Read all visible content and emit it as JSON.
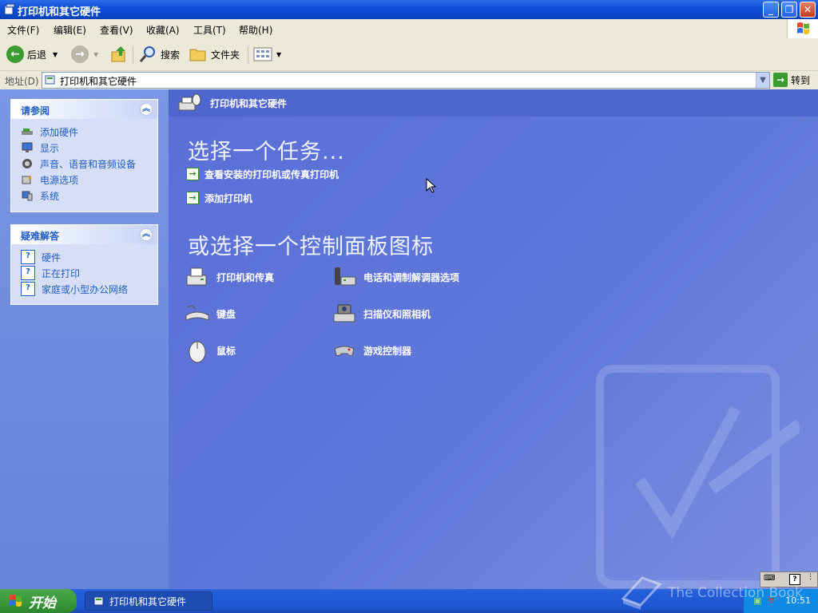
{
  "window": {
    "title": "打印机和其它硬件",
    "buttons": {
      "minimize": "_",
      "restore": "❐",
      "close": "✕"
    }
  },
  "menu": [
    "文件(F)",
    "编辑(E)",
    "查看(V)",
    "收藏(A)",
    "工具(T)",
    "帮助(H)"
  ],
  "toolbar": {
    "back_label": "后退",
    "search_label": "搜索",
    "folders_label": "文件夹"
  },
  "address": {
    "label": "地址(D)",
    "value": "打印机和其它硬件",
    "go_label": "转到"
  },
  "sidebar": {
    "see_also": {
      "title": "请参阅",
      "items": [
        {
          "label": "添加硬件",
          "icon": "add-hardware-icon"
        },
        {
          "label": "显示",
          "icon": "display-icon"
        },
        {
          "label": "声音、语音和音频设备",
          "icon": "sound-icon"
        },
        {
          "label": "电源选项",
          "icon": "power-icon"
        },
        {
          "label": "系统",
          "icon": "system-icon"
        }
      ]
    },
    "troubleshoot": {
      "title": "疑难解答",
      "items": [
        {
          "label": "硬件",
          "icon": "help-icon"
        },
        {
          "label": "正在打印",
          "icon": "help-icon"
        },
        {
          "label": "家庭或小型办公网络",
          "icon": "help-icon"
        }
      ]
    }
  },
  "main": {
    "header": "打印机和其它硬件",
    "pick_task_title": "选择一个任务...",
    "tasks": [
      "查看安装的打印机或传真打印机",
      "添加打印机"
    ],
    "pick_icon_title": "或选择一个控制面板图标",
    "icons": [
      {
        "label": "打印机和传真",
        "icon": "printer-icon"
      },
      {
        "label": "电话和调制解调器选项",
        "icon": "phone-icon"
      },
      {
        "label": "键盘",
        "icon": "keyboard-icon"
      },
      {
        "label": "扫描仪和照相机",
        "icon": "scanner-icon"
      },
      {
        "label": "鼠标",
        "icon": "mouse-icon"
      },
      {
        "label": "游戏控制器",
        "icon": "gamepad-icon"
      }
    ]
  },
  "taskbar": {
    "start_label": "开始",
    "task_label": "打印机和其它硬件",
    "clock": "10:51"
  },
  "watermark_text": "The Collection Book",
  "colors": {
    "xp_blue": "#0a46c8",
    "panel_link": "#215dc6",
    "start_green": "#3b9a3b"
  }
}
